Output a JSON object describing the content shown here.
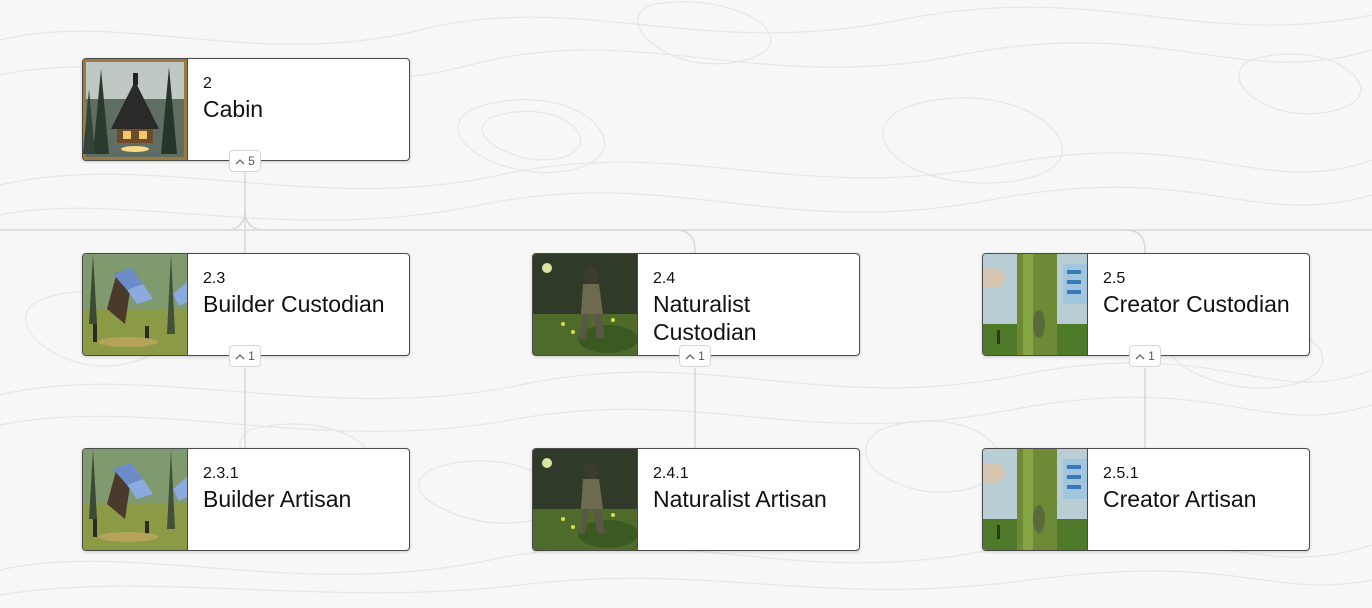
{
  "nodes": {
    "cabin": {
      "number": "2",
      "title": "Cabin",
      "children_count": "5",
      "thumbnail": "cabin-in-forest-image"
    },
    "builder_custodian": {
      "number": "2.3",
      "title": "Builder Custodian",
      "children_count": "1",
      "thumbnail": "solar-house-forest-image"
    },
    "naturalist_custodian": {
      "number": "2.4",
      "title": "Naturalist Custodian",
      "children_count": "1",
      "thumbnail": "forest-figure-image"
    },
    "creator_custodian": {
      "number": "2.5",
      "title": "Creator Custodian",
      "children_count": "1",
      "thumbnail": "mossy-tree-tech-image"
    },
    "builder_artisan": {
      "number": "2.3.1",
      "title": "Builder Artisan",
      "thumbnail": "solar-house-forest-image"
    },
    "naturalist_artisan": {
      "number": "2.4.1",
      "title": "Naturalist Artisan",
      "thumbnail": "forest-figure-image"
    },
    "creator_artisan": {
      "number": "2.5.1",
      "title": "Creator Artisan",
      "thumbnail": "mossy-tree-tech-image"
    }
  },
  "colors": {
    "background": "#f7f7f7",
    "connector": "#d9d9d9",
    "border": "#4a4a4a"
  },
  "icons": {
    "toggle": "chevron-up-icon"
  }
}
